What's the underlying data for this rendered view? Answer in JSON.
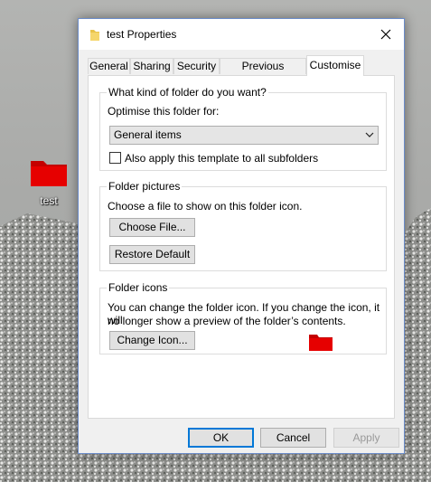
{
  "desktop": {
    "icon_label": "test"
  },
  "window": {
    "title": "test Properties"
  },
  "tabs": [
    {
      "label": "General"
    },
    {
      "label": "Sharing"
    },
    {
      "label": "Security"
    },
    {
      "label": "Previous Versions"
    },
    {
      "label": "Customise",
      "active": true
    }
  ],
  "folder_type": {
    "title": "What kind of folder do you want?",
    "optimise_label": "Optimise this folder for:",
    "selected": "General items",
    "apply_subfolders_label": "Also apply this template to all subfolders",
    "apply_subfolders_checked": false
  },
  "folder_pictures": {
    "title": "Folder pictures",
    "description": "Choose a file to show on this folder icon.",
    "choose_file_label": "Choose File...",
    "restore_default_label": "Restore Default"
  },
  "folder_icons": {
    "title": "Folder icons",
    "description_line1": "You can change the folder icon. If you change the icon, it will",
    "description_line2": "no longer show a preview of the folder’s contents.",
    "change_icon_label": "Change Icon..."
  },
  "buttons": {
    "ok": "OK",
    "cancel": "Cancel",
    "apply": "Apply"
  },
  "colors": {
    "folder_red": "#e00000",
    "accent": "#0078d7"
  },
  "icons": {
    "folder": "folder-icon",
    "close": "close-icon",
    "dropdown": "chevron-down-icon"
  }
}
